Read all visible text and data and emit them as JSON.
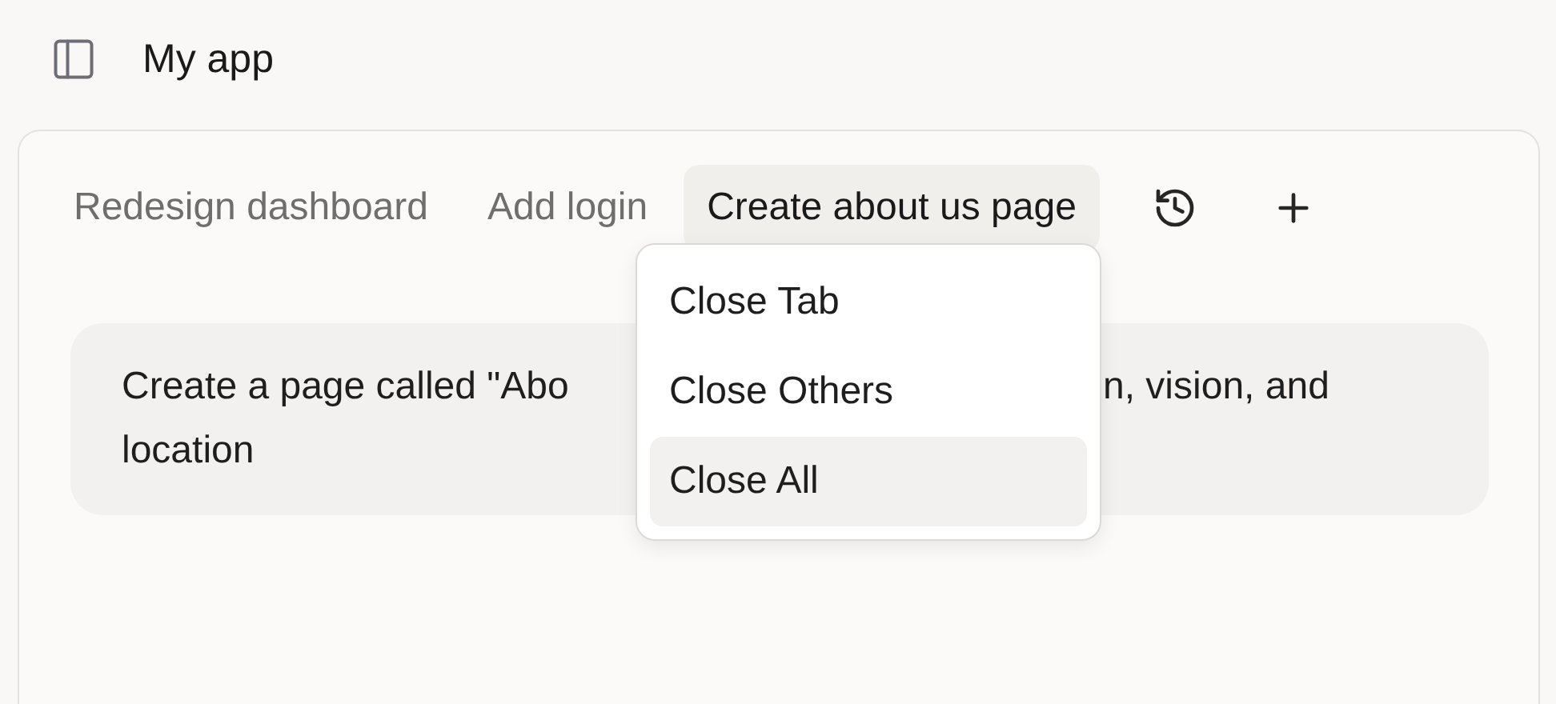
{
  "app": {
    "title": "My app"
  },
  "tabs": [
    {
      "label": "Redesign dashboard",
      "selected": false
    },
    {
      "label": "Add login",
      "selected": false
    },
    {
      "label": "Create about us page",
      "selected": true
    }
  ],
  "message": {
    "visible_parts": [
      "Create a page called \"Abo",
      "n, vision, and",
      "location"
    ]
  },
  "context_menu": {
    "items": [
      {
        "label": "Close Tab",
        "selected": false
      },
      {
        "label": "Close Others",
        "selected": false
      },
      {
        "label": "Close All",
        "selected": true
      }
    ]
  }
}
